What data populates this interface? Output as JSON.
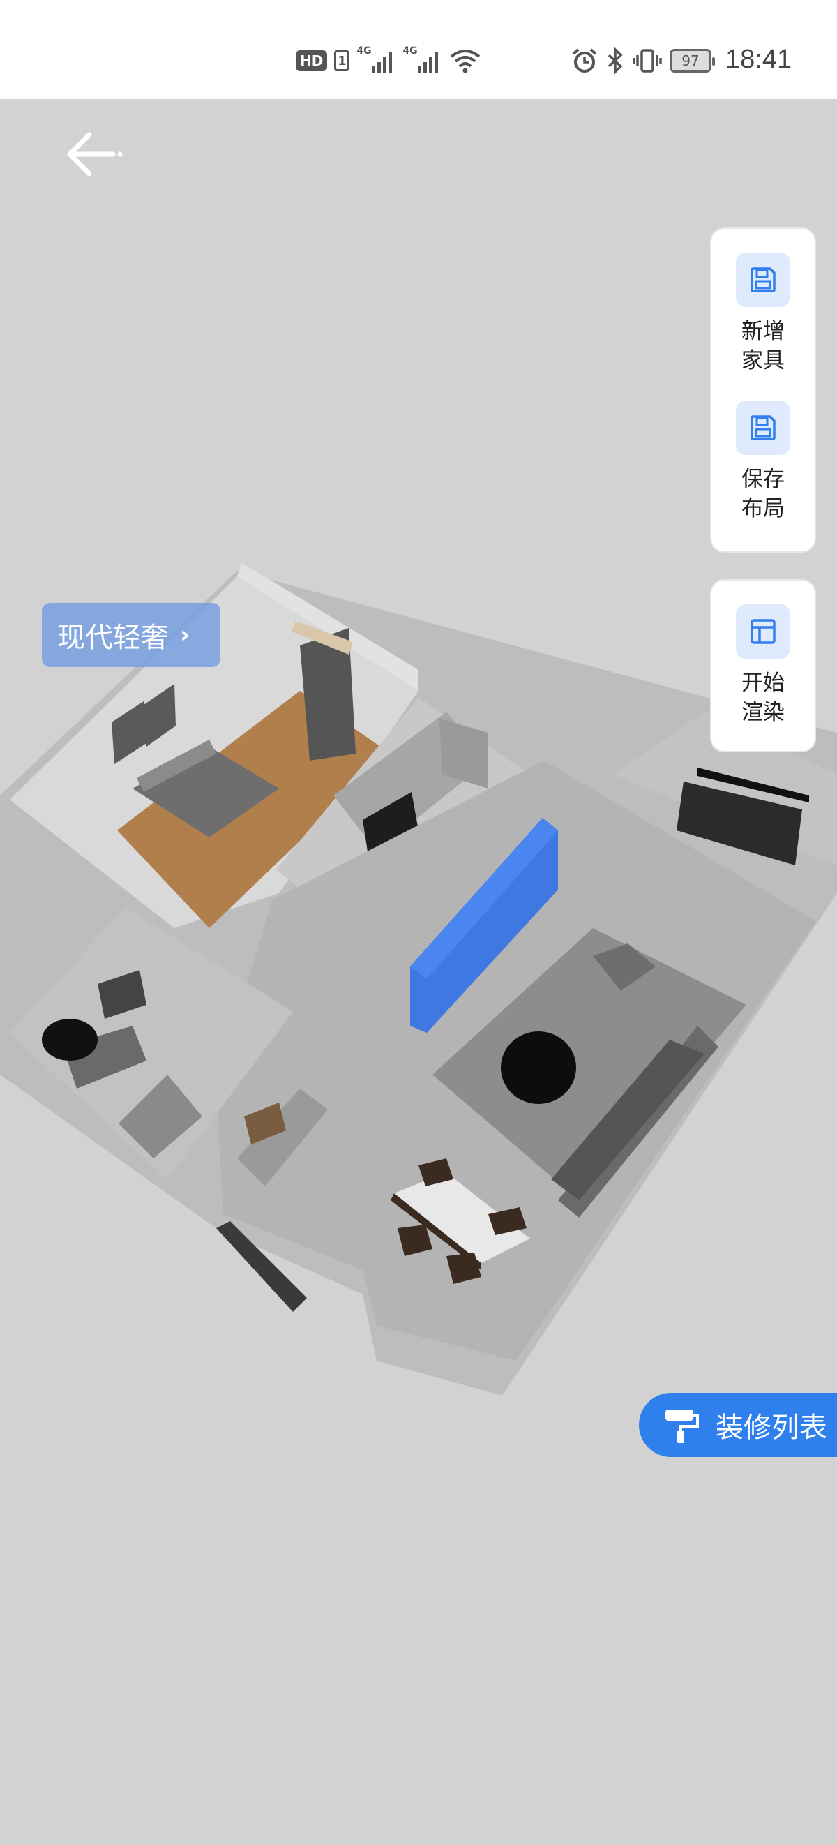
{
  "statusbar": {
    "left_icons": [
      "hd-badge",
      "sim-1-badge",
      "signal-4g-icon",
      "signal-4g-icon",
      "wifi-icon"
    ],
    "hd_label": "HD",
    "sim_label": "1",
    "net1_label": "4G",
    "net2_label": "4G",
    "right_icons": [
      "alarm-icon",
      "bluetooth-icon",
      "vibrate-icon",
      "battery-icon"
    ],
    "battery_level": "97",
    "time": "18:41"
  },
  "nav": {
    "back_icon": "arrow-left-icon"
  },
  "style_tag": {
    "label": "现代轻奢",
    "icon": "chevron-right-icon"
  },
  "toolbar": {
    "tools": [
      {
        "label": "新增家具",
        "icon": "floppy-disk-icon"
      },
      {
        "label": "保存布局",
        "icon": "floppy-disk-icon"
      }
    ],
    "render": {
      "label": "开始渲染",
      "icon": "layout-icon"
    }
  },
  "fab": {
    "label": "装修列表",
    "icon": "paint-roller-icon"
  },
  "colors": {
    "accent": "#2f80ed",
    "icon_bg": "#dfeafc",
    "canvas_bg": "#d2d2d2",
    "selection": "#2f6fe6"
  }
}
